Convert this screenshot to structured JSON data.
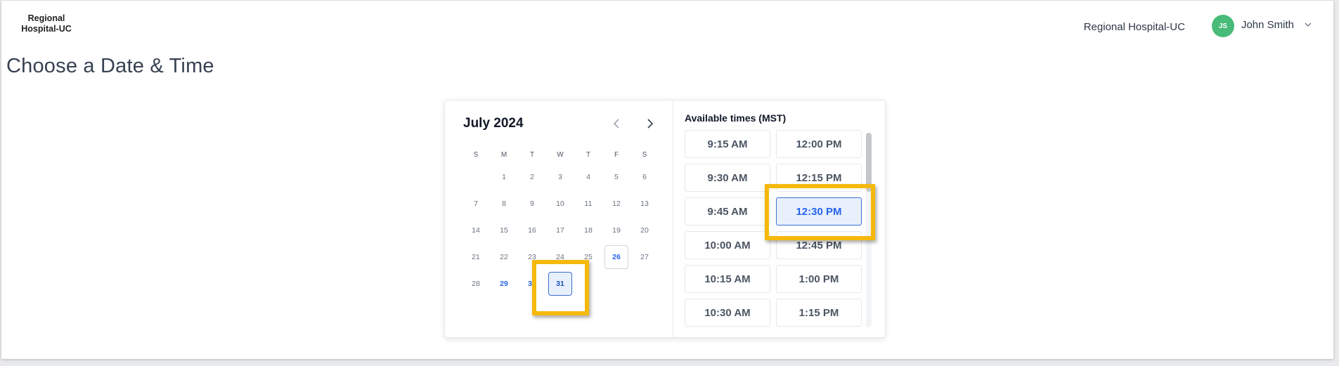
{
  "header": {
    "logo_line1": "Regional",
    "logo_line2": "Hospital-UC",
    "org_name": "Regional Hospital-UC",
    "user_initials": "JS",
    "user_name": "John Smith",
    "avatar_color": "#48bb78"
  },
  "page_title": "Choose a Date & Time",
  "calendar": {
    "month_label": "July 2024",
    "weekdays": [
      "S",
      "M",
      "T",
      "W",
      "T",
      "F",
      "S"
    ],
    "weeks": [
      [
        "",
        "1",
        "2",
        "3",
        "4",
        "5",
        "6"
      ],
      [
        "7",
        "8",
        "9",
        "10",
        "11",
        "12",
        "13"
      ],
      [
        "14",
        "15",
        "16",
        "17",
        "18",
        "19",
        "20"
      ],
      [
        "21",
        "22",
        "23",
        "24",
        "25",
        "26",
        "27"
      ],
      [
        "28",
        "29",
        "30",
        "31",
        "",
        "",
        ""
      ]
    ],
    "available_dates": [
      "26",
      "29",
      "30",
      "31"
    ],
    "selected_date": "31"
  },
  "times": {
    "title": "Available times (MST)",
    "slots": [
      "9:15 AM",
      "12:00 PM",
      "9:30 AM",
      "12:15 PM",
      "9:45 AM",
      "12:30 PM",
      "10:00 AM",
      "12:45 PM",
      "10:15 AM",
      "1:00 PM",
      "10:30 AM",
      "1:15 PM"
    ],
    "selected_slot": "12:30 PM"
  },
  "colors": {
    "accent": "#2563eb",
    "selected_bg": "#e8f0fd",
    "highlight": "#f5b90d"
  }
}
